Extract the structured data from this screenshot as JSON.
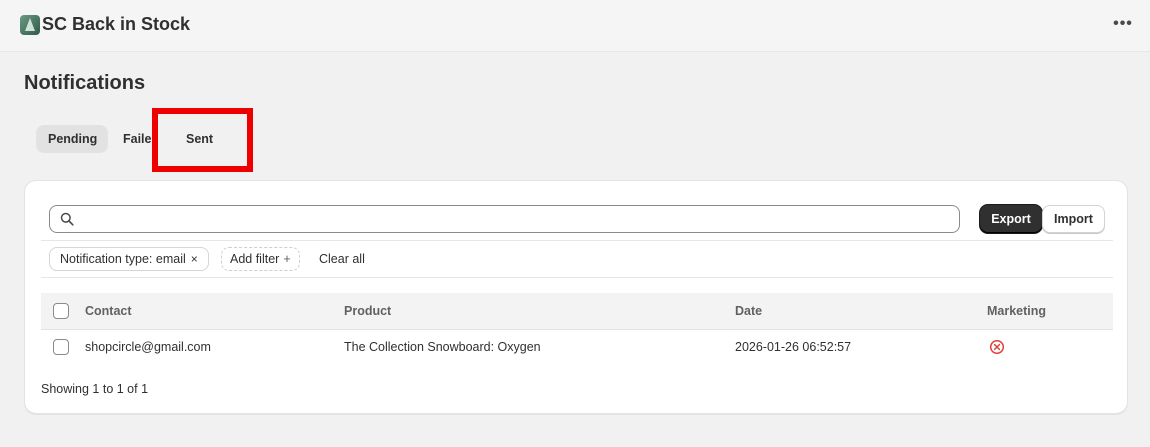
{
  "app": {
    "title": "SC Back in Stock",
    "icon": "app-logo-icon",
    "more_label": "•••"
  },
  "page": {
    "title": "Notifications"
  },
  "tabs": [
    {
      "label": "Pending",
      "active": true
    },
    {
      "label": "Failed",
      "active": false
    },
    {
      "label": "Sent",
      "active": false
    }
  ],
  "toolbar": {
    "search_placeholder": "",
    "export_label": "Export",
    "import_label": "Import"
  },
  "filters": {
    "chip_label": "Notification type: email",
    "chip_remove": "×",
    "add_filter_label": "Add filter",
    "add_filter_icon": "+",
    "clear_all_label": "Clear all"
  },
  "table": {
    "columns": [
      "Contact",
      "Product",
      "Date",
      "Marketing"
    ],
    "rows": [
      {
        "contact": "shopcircle@gmail.com",
        "product": "The Collection Snowboard: Oxygen",
        "date": "2026-01-26 06:52:57",
        "marketing_icon": "x-circle-icon"
      }
    ]
  },
  "footer": {
    "showing": "Showing 1 to 1 of 1"
  },
  "colors": {
    "highlight": "#ee0000",
    "marketing_no": "#e0413a"
  }
}
